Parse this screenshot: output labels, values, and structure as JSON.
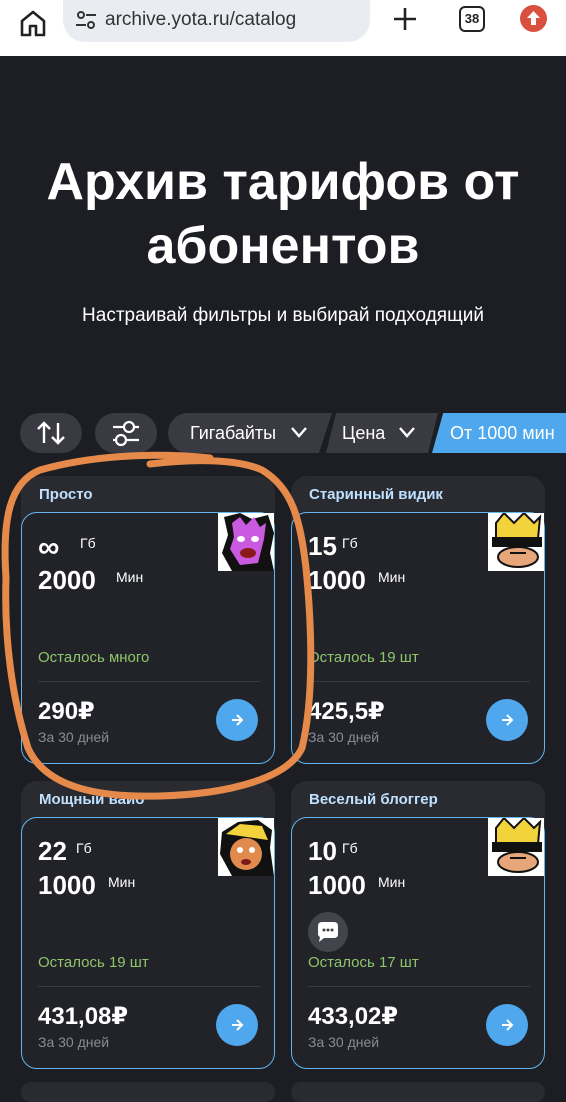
{
  "browser": {
    "url": "archive.yota.ru/catalog",
    "tab_count": "38"
  },
  "hero": {
    "title": "Архив тарифов от абонентов",
    "subtitle": "Настраивай фильтры и выбирай подходящий"
  },
  "filters": {
    "gigabytes_label": "Гигабайты",
    "price_label": "Цена",
    "minutes_label": "От 1000 мин"
  },
  "tariffs": [
    {
      "name": "Просто",
      "gb": "∞",
      "gb_unit": "Гб",
      "min": "2000",
      "min_unit": "Мин",
      "left": "Осталось много",
      "price": "290₽",
      "period": "За 30 дней"
    },
    {
      "name": "Старинный видик",
      "gb": "15",
      "gb_unit": "Гб",
      "min": "1000",
      "min_unit": "Мин",
      "left": "Осталось 19 шт",
      "price": "425,5₽",
      "period": "За 30 дней"
    },
    {
      "name": "Мощный вайб",
      "gb": "22",
      "gb_unit": "Гб",
      "min": "1000",
      "min_unit": "Мин",
      "left": "Осталось 19 шт",
      "price": "431,08₽",
      "period": "За 30 дней"
    },
    {
      "name": "Веселый блоггер",
      "gb": "10",
      "gb_unit": "Гб",
      "min": "1000",
      "min_unit": "Мин",
      "left": "Осталось 17 шт",
      "price": "433,02₽",
      "period": "За 30 дней"
    }
  ],
  "colors": {
    "background": "#1d1e23",
    "card": "#2a2b30",
    "accent": "#4fa8ee",
    "remaining": "#8fc56a",
    "annotation": "#e58a4a"
  }
}
